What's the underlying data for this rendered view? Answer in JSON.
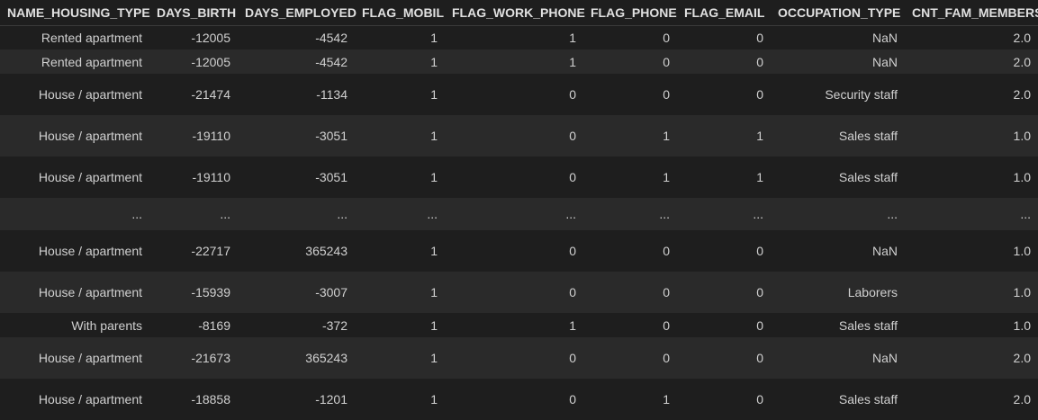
{
  "table": {
    "columns": [
      "NAME_HOUSING_TYPE",
      "DAYS_BIRTH",
      "DAYS_EMPLOYED",
      "FLAG_MOBIL",
      "FLAG_WORK_PHONE",
      "FLAG_PHONE",
      "FLAG_EMAIL",
      "OCCUPATION_TYPE",
      "CNT_FAM_MEMBERS"
    ],
    "rows": [
      [
        "Rented apartment",
        "-12005",
        "-4542",
        "1",
        "1",
        "0",
        "0",
        "NaN",
        "2.0"
      ],
      [
        "Rented apartment",
        "-12005",
        "-4542",
        "1",
        "1",
        "0",
        "0",
        "NaN",
        "2.0"
      ],
      [
        "House / apartment",
        "-21474",
        "-1134",
        "1",
        "0",
        "0",
        "0",
        "Security staff",
        "2.0"
      ],
      [
        "House / apartment",
        "-19110",
        "-3051",
        "1",
        "0",
        "1",
        "1",
        "Sales staff",
        "1.0"
      ],
      [
        "House / apartment",
        "-19110",
        "-3051",
        "1",
        "0",
        "1",
        "1",
        "Sales staff",
        "1.0"
      ],
      [
        "...",
        "...",
        "...",
        "...",
        "...",
        "...",
        "...",
        "...",
        "..."
      ],
      [
        "House / apartment",
        "-22717",
        "365243",
        "1",
        "0",
        "0",
        "0",
        "NaN",
        "1.0"
      ],
      [
        "House / apartment",
        "-15939",
        "-3007",
        "1",
        "0",
        "0",
        "0",
        "Laborers",
        "1.0"
      ],
      [
        "With parents",
        "-8169",
        "-372",
        "1",
        "1",
        "0",
        "0",
        "Sales staff",
        "1.0"
      ],
      [
        "House / apartment",
        "-21673",
        "365243",
        "1",
        "0",
        "0",
        "0",
        "NaN",
        "2.0"
      ],
      [
        "House / apartment",
        "-18858",
        "-1201",
        "1",
        "0",
        "1",
        "0",
        "Sales staff",
        "2.0"
      ]
    ]
  }
}
